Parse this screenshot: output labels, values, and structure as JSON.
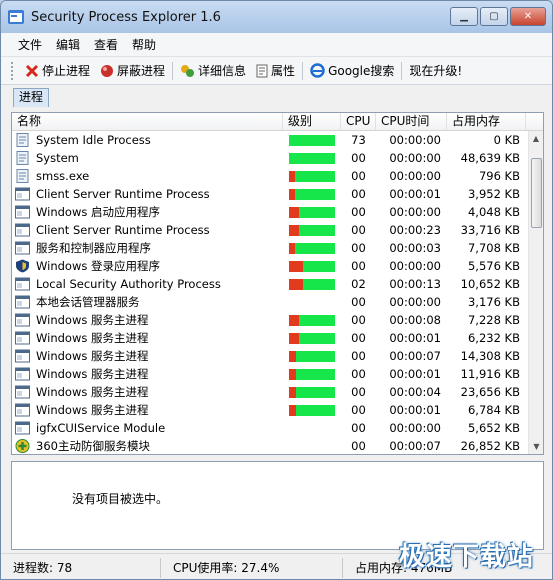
{
  "window": {
    "title": "Security Process Explorer 1.6"
  },
  "menu": [
    "文件",
    "编辑",
    "查看",
    "帮助"
  ],
  "toolbar": {
    "stop_label": "停止进程",
    "block_label": "屏蔽进程",
    "details_label": "详细信息",
    "props_label": "属性",
    "google_label": "Google搜索",
    "upgrade_label": "现在升级!"
  },
  "tab": "进程",
  "columns": {
    "name": "名称",
    "level": "级别",
    "cpu": "CPU",
    "time": "CPU时间",
    "mem": "占用内存"
  },
  "processes": [
    {
      "name": "System Idle Process",
      "risk": 0,
      "cpu": "73",
      "time": "00:00:00",
      "mem": "0 KB",
      "icon": "process-page-icon"
    },
    {
      "name": "System",
      "risk": 0,
      "cpu": "00",
      "time": "00:00:00",
      "mem": "48,639 KB",
      "icon": "process-page-icon"
    },
    {
      "name": "smss.exe",
      "risk": 0.12,
      "cpu": "00",
      "time": "00:00:00",
      "mem": "796 KB",
      "icon": "process-page-icon"
    },
    {
      "name": "Client Server Runtime Process",
      "risk": 0.12,
      "cpu": "00",
      "time": "00:00:01",
      "mem": "3,952 KB",
      "icon": "process-window-icon"
    },
    {
      "name": "Windows 启动应用程序",
      "risk": 0.22,
      "cpu": "00",
      "time": "00:00:00",
      "mem": "4,048 KB",
      "icon": "process-window-icon"
    },
    {
      "name": "Client Server Runtime Process",
      "risk": 0.22,
      "cpu": "00",
      "time": "00:00:23",
      "mem": "33,716 KB",
      "icon": "process-window-icon"
    },
    {
      "name": "服务和控制器应用程序",
      "risk": 0.12,
      "cpu": "00",
      "time": "00:00:03",
      "mem": "7,708 KB",
      "icon": "process-window-icon"
    },
    {
      "name": "Windows 登录应用程序",
      "risk": 0.3,
      "cpu": "00",
      "time": "00:00:00",
      "mem": "5,576 KB",
      "icon": "process-shield-icon"
    },
    {
      "name": "Local Security Authority Process",
      "risk": 0.3,
      "cpu": "02",
      "time": "00:00:13",
      "mem": "10,652 KB",
      "icon": "process-window-icon"
    },
    {
      "name": "本地会话管理器服务",
      "risk": null,
      "cpu": "00",
      "time": "00:00:00",
      "mem": "3,176 KB",
      "icon": "process-window-icon"
    },
    {
      "name": "Windows 服务主进程",
      "risk": 0.22,
      "cpu": "00",
      "time": "00:00:08",
      "mem": "7,228 KB",
      "icon": "process-window-icon"
    },
    {
      "name": "Windows 服务主进程",
      "risk": 0.22,
      "cpu": "00",
      "time": "00:00:01",
      "mem": "6,232 KB",
      "icon": "process-window-icon"
    },
    {
      "name": "Windows 服务主进程",
      "risk": 0.15,
      "cpu": "00",
      "time": "00:00:07",
      "mem": "14,308 KB",
      "icon": "process-window-icon"
    },
    {
      "name": "Windows 服务主进程",
      "risk": 0.15,
      "cpu": "00",
      "time": "00:00:01",
      "mem": "11,916 KB",
      "icon": "process-window-icon"
    },
    {
      "name": "Windows 服务主进程",
      "risk": 0.15,
      "cpu": "00",
      "time": "00:00:04",
      "mem": "23,656 KB",
      "icon": "process-window-icon"
    },
    {
      "name": "Windows 服务主进程",
      "risk": 0.15,
      "cpu": "00",
      "time": "00:00:01",
      "mem": "6,784 KB",
      "icon": "process-window-icon"
    },
    {
      "name": "igfxCUIService Module",
      "risk": null,
      "cpu": "00",
      "time": "00:00:00",
      "mem": "5,652 KB",
      "icon": "process-window-icon"
    },
    {
      "name": "360主动防御服务模块",
      "risk": null,
      "cpu": "00",
      "time": "00:00:07",
      "mem": "26,852 KB",
      "icon": "process-360-icon"
    }
  ],
  "detail": {
    "empty_text": "没有项目被选中。"
  },
  "status": {
    "count": "进程数: 78",
    "cpu_usage": "CPU使用率: 27.4%",
    "mem_usage": "占用内存: 476MB"
  },
  "watermark": "极速下载站",
  "colors": {
    "level_green": "#16e64a",
    "level_red": "#e23a1c",
    "window_frame": "#6f8aa8"
  }
}
